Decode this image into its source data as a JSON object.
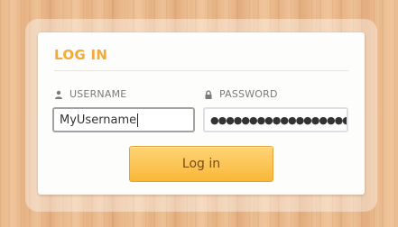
{
  "login": {
    "title": "LOG IN",
    "username_label": "USERNAME",
    "password_label": "PASSWORD",
    "username_value": "MyUsername",
    "password_masked": "●●●●●●●●●●●●●●●●●●●",
    "submit_label": "Log in"
  },
  "icons": {
    "username": "user-icon",
    "password": "lock-icon"
  },
  "colors": {
    "accent": "#f4a93a",
    "button": "#f8b93a"
  }
}
